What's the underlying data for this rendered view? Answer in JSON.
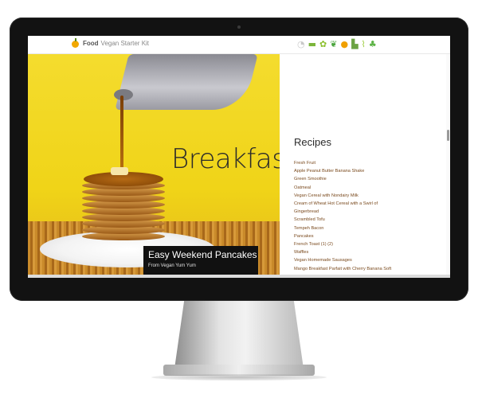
{
  "site": {
    "brand": "Food",
    "kit": "Vegan Starter Kit"
  },
  "nav": {
    "icons": [
      "cat-icon",
      "cow-icon",
      "butterfly-icon",
      "leaf-icon",
      "fruit-icon",
      "boot-icon",
      "plant-icon",
      "tree-icon"
    ]
  },
  "hero": {
    "title": "Breakfast",
    "caption_title": "Easy Weekend Pancakes",
    "caption_sub": "From Vegan Yum Yum"
  },
  "recipes": {
    "heading": "Recipes",
    "items": [
      "Fresh Fruit",
      "Apple Peanut Butter Banana Shake",
      "Green Smoothie",
      "Oatmeal",
      "Vegan Cereal with Nondairy Milk",
      "Cream of Wheat Hot Cereal with a Swirl of",
      "Gingerbread",
      "Scrambled Tofu",
      "Tempeh Bacon",
      "Pancakes",
      "French Toast (1) (2)",
      "Waffles",
      "Vegan Homemade Sausages",
      "Mango Breakfast Parfait with Cherry Banana Soft"
    ]
  },
  "colors": {
    "photo_background": "#f0d418",
    "recipe_link": "#7a4a1e",
    "brand_accent": "#f2a800"
  }
}
